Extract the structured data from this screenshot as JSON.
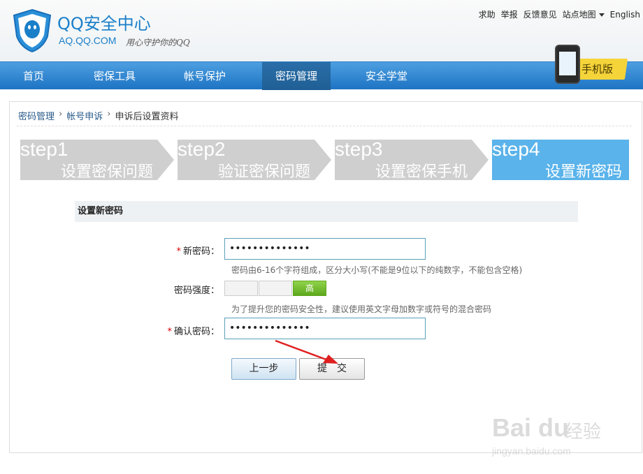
{
  "header": {
    "brand_title": "QQ安全中心",
    "brand_domain": "AQ.QQ.COM",
    "brand_slogan": "用心守护你的QQ",
    "top_links": [
      "求助",
      "举报",
      "反馈意见",
      "站点地图",
      "English"
    ],
    "mobile_badge": "手机版"
  },
  "nav": {
    "items": [
      "首页",
      "密保工具",
      "帐号保护",
      "密码管理",
      "安全学堂"
    ],
    "active": "密码管理"
  },
  "breadcrumb": [
    "密码管理",
    "帐号申诉",
    "申诉后设置资料"
  ],
  "steps": [
    {
      "num": "step1",
      "label": "设置密保问题",
      "active": false
    },
    {
      "num": "step2",
      "label": "验证密保问题",
      "active": false
    },
    {
      "num": "step3",
      "label": "设置密保手机",
      "active": false
    },
    {
      "num": "step4",
      "label": "设置新密码",
      "active": true
    }
  ],
  "form": {
    "section_title": "设置新密码",
    "new_password_label": "新密码：",
    "new_password_value": "••••••••••••••",
    "new_password_hint": "密码由6-16个字符组成，区分大小写(不能是9位以下的纯数字，不能包含空格)",
    "strength_label": "密码强度：",
    "strength_level": "高",
    "strength_hint": "为了提升您的密码安全性，建议使用英文字母加数字或符号的混合密码",
    "confirm_label": "确认密码：",
    "confirm_value": "••••••••••••••",
    "prev_button": "上一步",
    "submit_button": "提　交"
  },
  "watermark": {
    "logo": "Bai du",
    "cn": "经验",
    "url": "jingyan.baidu.com"
  },
  "colors": {
    "brand_blue": "#1a7fc9",
    "nav_blue": "#1e74c4",
    "step_gray": "#cfcfcf",
    "step_active": "#5ab3ea",
    "required_red": "#dd0000",
    "arrow_red": "#e02020"
  }
}
